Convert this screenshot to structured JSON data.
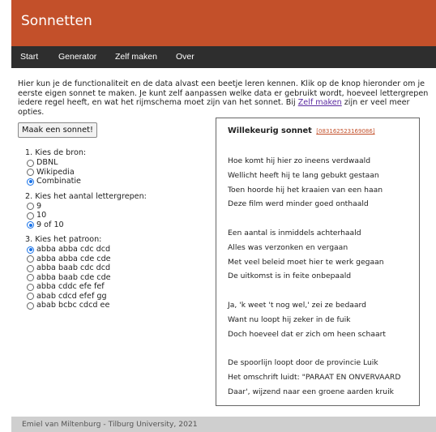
{
  "header": {
    "title": "Sonnetten"
  },
  "nav": {
    "items": [
      "Start",
      "Generator",
      "Zelf maken",
      "Over"
    ]
  },
  "intro": {
    "text_before": "Hier kun je de functionaliteit en de data alvast een beetje leren kennen. Klik op de knop hieronder om je eerste eigen sonnet te maken. Je kunt zelf aanpassen welke data er gebruikt wordt, hoeveel lettergrepen iedere regel heeft, en wat het rijmschema moet zijn van het sonnet. Bij ",
    "link": "Zelf maken",
    "text_after": " zijn er veel meer opties."
  },
  "button": {
    "label": "Maak een sonnet!"
  },
  "options": {
    "source": {
      "title": "1. Kies de bron:",
      "items": [
        "DBNL",
        "Wikipedia",
        "Combinatie"
      ],
      "selected": "Combinatie"
    },
    "syllables": {
      "title": "2. Kies het aantal lettergrepen:",
      "items": [
        "9",
        "10",
        "9 of 10"
      ],
      "selected": "9 of 10"
    },
    "pattern": {
      "title": "3. Kies het patroon:",
      "items": [
        "abba abba cdc dcd",
        "abba abba cde cde",
        "abba baab cdc dcd",
        "abba baab cde cde",
        "abba cddc efe fef",
        "abab cdcd efef gg",
        "abab bcbc cdcd ee"
      ],
      "selected": "abba abba cdc dcd"
    }
  },
  "sonnet": {
    "title": "Willekeurig sonnet",
    "id": "[083162523169086]",
    "stanzas": [
      [
        "Hoe komt hij hier zo ineens verdwaald",
        "Wellicht heeft hij te lang gebukt gestaan",
        "Toen hoorde hij het kraaien van een haan",
        "Deze film werd minder goed onthaald"
      ],
      [
        "Een aantal is inmiddels achterhaald",
        "Alles was verzonken en vergaan",
        "Met veel beleid moet hier te werk gegaan",
        "De uitkomst is in feite onbepaald"
      ],
      [
        "Ja, 'k weet 't nog wel,' zei ze bedaard",
        "Want nu loopt hij zeker in de fuik",
        "Doch hoeveel dat er zich om heen schaart"
      ],
      [
        "De spoorlijn loopt door de provincie Luik",
        "Het omschrift luidt: \"PARAAT EN ONVERVAARD",
        "Daar', wijzend naar een groene aarden kruik"
      ]
    ]
  },
  "footer": {
    "text": "Emiel van Miltenburg - Tilburg University, 2021"
  },
  "colors": {
    "header_bg": "#c3502a",
    "nav_bg": "#2e2e2e",
    "footer_bg": "#cfcfcf",
    "radio_selected": "#1a73e8"
  }
}
